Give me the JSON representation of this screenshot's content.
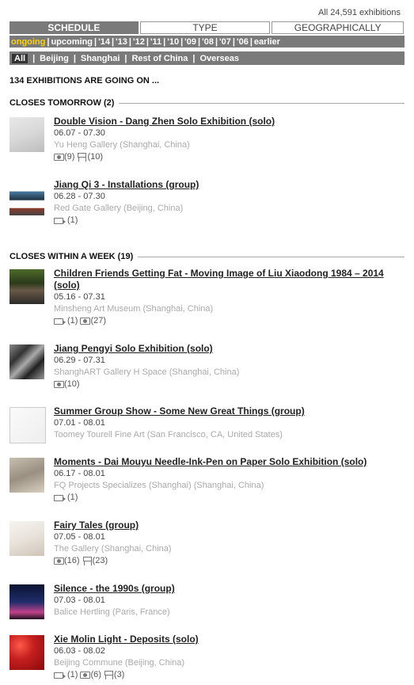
{
  "total_label": "All 24,591 exhibitions",
  "tabs": [
    "SCHEDULE",
    "TYPE",
    "GEOGRAPHICALLY"
  ],
  "years": [
    "ongoing",
    "upcoming",
    "'14",
    "'13",
    "'12",
    "'11",
    "'10",
    "'09",
    "'08",
    "'07",
    "'06",
    "earlier"
  ],
  "regions": [
    "All",
    "Beijing",
    "Shanghai",
    "Rest of China",
    "Overseas"
  ],
  "count_label": "134 EXHIBITIONS ARE GOING ON ...",
  "sections": [
    {
      "label": "CLOSES TOMORROW (2)"
    },
    {
      "label": "CLOSES WITHIN A WEEK (19)"
    }
  ],
  "exhibitions": [
    {
      "title": "Double Vision - Dang Zhen Solo Exhibition (solo)",
      "dates": "06.07 - 07.30",
      "venue": "Yu Heng Gallery (Shanghai, China)",
      "media": [
        {
          "icon": "camera-icon",
          "count": "(9)"
        },
        {
          "icon": "easel-icon",
          "count": "(10)"
        }
      ]
    },
    {
      "title": "Jiang Qi 3 - Installations (group)",
      "dates": "06.28 - 07.30",
      "venue": "Red Gate Gallery (Beijing, China)",
      "media": [
        {
          "icon": "video-icon",
          "count": "(1)"
        }
      ]
    },
    {
      "title": "Children Friends Getting Fat - Moving Image of Liu Xiaodong 1984 – 2014 (solo)",
      "dates": "05.16 - 07.31",
      "venue": "Minsheng Art Museum (Shanghai, China)",
      "media": [
        {
          "icon": "video-icon",
          "count": "(1)"
        },
        {
          "icon": "camera-icon",
          "count": "(27)"
        }
      ]
    },
    {
      "title": "Jiang Pengyi Solo Exhibition (solo)",
      "dates": "06.29 - 07.31",
      "venue": "ShanghART Gallery H Space (Shanghai, China)",
      "media": [
        {
          "icon": "camera-icon",
          "count": "(10)"
        }
      ]
    },
    {
      "title": "Summer Group Show - Some New Great Things (group)",
      "dates": "07.01 - 08.01",
      "venue": "Toomey Tourell Fine Art (San Francisco, CA, United States)",
      "media": []
    },
    {
      "title": "Moments - Dai Mouyu Needle-Ink-Pen on Paper Solo Exhibition (solo)",
      "dates": "06.17 - 08.01",
      "venue": "FQ Projects Specializes (Shanghai) (Shanghai, China)",
      "media": [
        {
          "icon": "video-icon",
          "count": "(1)"
        }
      ]
    },
    {
      "title": "Fairy Tales (group)",
      "dates": "07.05 - 08.01",
      "venue": "The Gallery (Shanghai, China)",
      "media": [
        {
          "icon": "camera-icon",
          "count": "(16)"
        },
        {
          "icon": "easel-icon",
          "count": "(23)"
        }
      ]
    },
    {
      "title": "Silence - the 1990s (group)",
      "dates": "07.03 - 08.01",
      "venue": "Balice Hertling (Paris, France)",
      "media": []
    },
    {
      "title": "Xie Molin Light - Deposits (solo)",
      "dates": "06.03 - 08.02",
      "venue": "Beijing Commune (Beijing, China)",
      "media": [
        {
          "icon": "video-icon",
          "count": "(1)"
        },
        {
          "icon": "camera-icon",
          "count": "(6)"
        },
        {
          "icon": "easel-icon",
          "count": "(3)"
        }
      ]
    }
  ]
}
